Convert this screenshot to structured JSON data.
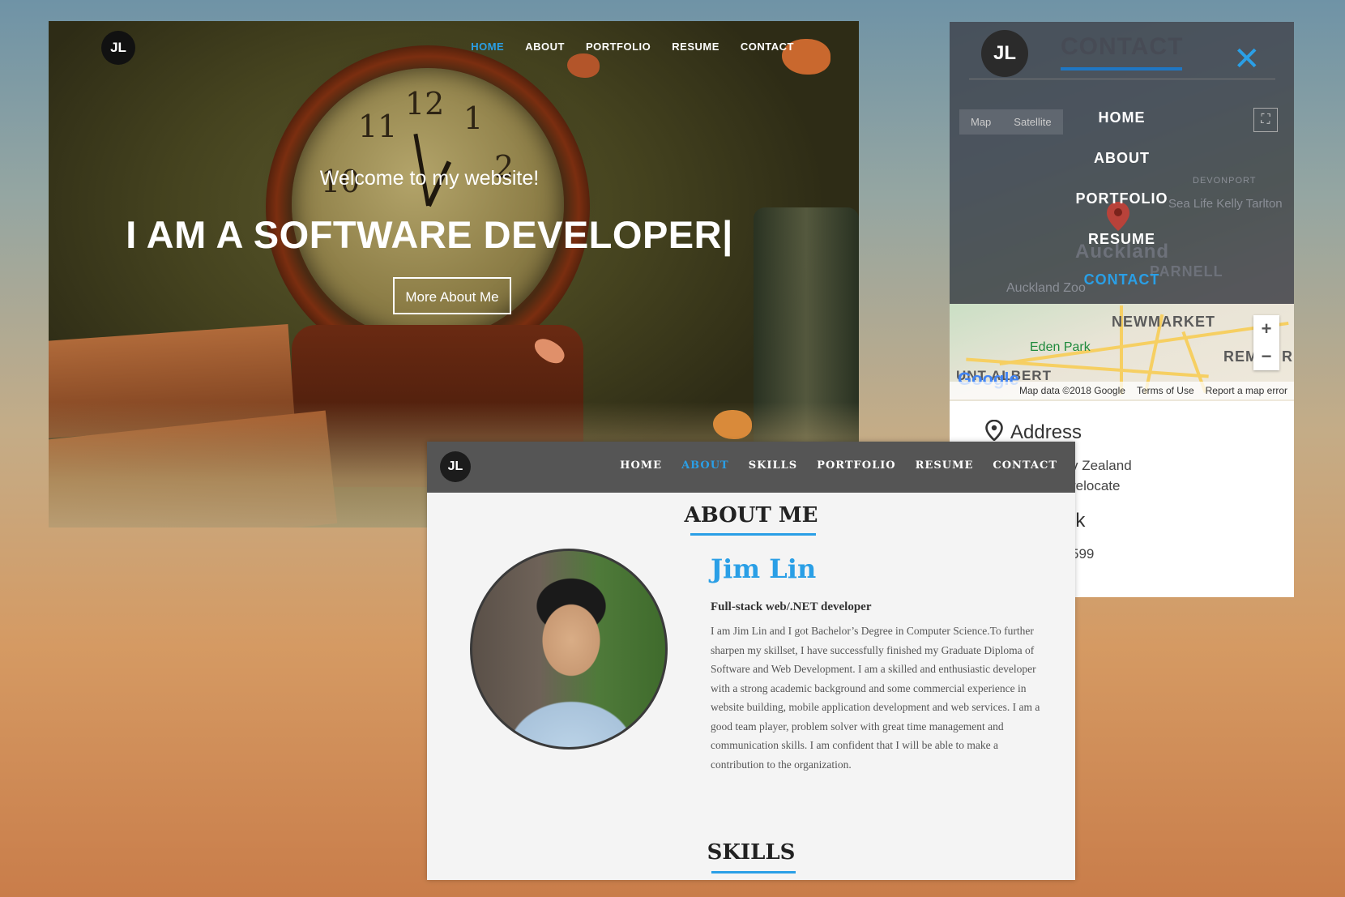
{
  "hero": {
    "logo": "JL",
    "nav": [
      "HOME",
      "ABOUT",
      "PORTFOLIO",
      "RESUME",
      "CONTACT"
    ],
    "active_nav": "HOME",
    "welcome": "Welcome to my website!",
    "headline": "I AM A SOFTWARE DEVELOPER|",
    "cta": "More About Me",
    "clock_numbers": [
      "11",
      "12",
      "1",
      "10",
      "2"
    ]
  },
  "contact": {
    "logo": "JL",
    "title": "CONTACT",
    "menu": [
      "HOME",
      "ABOUT",
      "PORTFOLIO",
      "RESUME",
      "CONTACT"
    ],
    "active_menu": "CONTACT",
    "map": {
      "types": [
        "Map",
        "Satellite"
      ],
      "labels": {
        "auckland": "Auckland",
        "parnell": "PARNELL",
        "devonport": "DEVONPORT",
        "sealife": "Sea Life Kelly Tarlton",
        "zoo": "Auckland Zoo",
        "newmarket": "NEWMARKET",
        "edenpark": "Eden Park",
        "mtalbert": "UNT ALBERT",
        "rem": "REM",
        "r": "R"
      },
      "zoom_in": "+",
      "zoom_out": "−",
      "attribution": [
        "Map data ©2018 Google",
        "Terms of Use",
        "Report a map error"
      ],
      "google": "Google"
    },
    "address_title": "Address",
    "address_line1": "v Zealand",
    "address_line2": "relocate",
    "talk_title": "lk",
    "phone": "599"
  },
  "about": {
    "logo": "JL",
    "nav": [
      "HOME",
      "ABOUT",
      "SKILLS",
      "PORTFOLIO",
      "RESUME",
      "CONTACT"
    ],
    "active_nav": "ABOUT",
    "section_title": "ABOUT ME",
    "name": "Jim Lin",
    "role": "Full-stack web/.NET developer",
    "bio": "I am Jim Lin and I got Bachelor’s Degree in Computer Science.To further sharpen my skillset, I have successfully finished my Graduate Diploma of Software and Web Development. I am a skilled and enthusiastic developer with a strong academic background and some commercial experience in website building, mobile application development and web services. I am a good team player, problem solver with great time management and communication skills. I am confident that I will be able to make a contribution to the organization.",
    "next_section": "SKILLS"
  },
  "colors": {
    "accent": "#2a9fe6",
    "contact_underline": "#1f77c4",
    "about_navbar": "#555555"
  }
}
